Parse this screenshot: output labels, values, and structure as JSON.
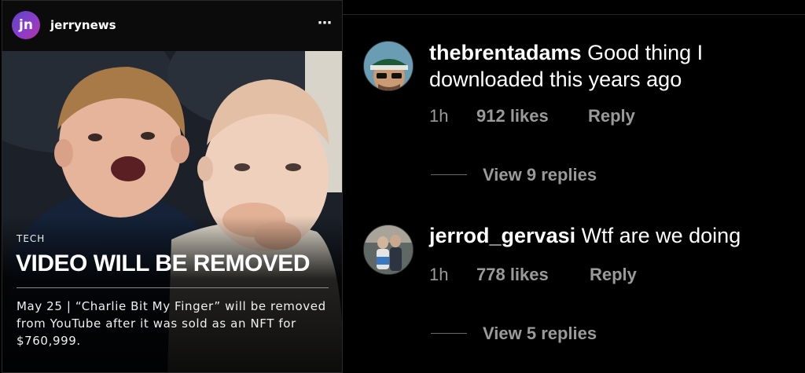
{
  "post": {
    "avatar_initials": "jn",
    "username": "jerrynews",
    "more_icon": "⋯",
    "category": "TECH",
    "headline": "VIDEO WILL BE REMOVED",
    "caption": "May 25 | “Charlie Bit My Finger” will be removed from YouTube after it was sold as an NFT for $760,999."
  },
  "comments": [
    {
      "username": "thebrentadams",
      "text": "Good thing I downloaded this years ago",
      "time": "1h",
      "likes": "912 likes",
      "reply": "Reply",
      "view_replies": "View 9 replies"
    },
    {
      "username": "jerrod_gervasi",
      "text": "Wtf are we doing",
      "time": "1h",
      "likes": "778 likes",
      "reply": "Reply",
      "view_replies": "View 5 replies"
    }
  ],
  "colors": {
    "background": "#000000",
    "meta_text": "#9a9a9a",
    "avatar_gradient": [
      "#5d46c8",
      "#b6359a"
    ]
  }
}
